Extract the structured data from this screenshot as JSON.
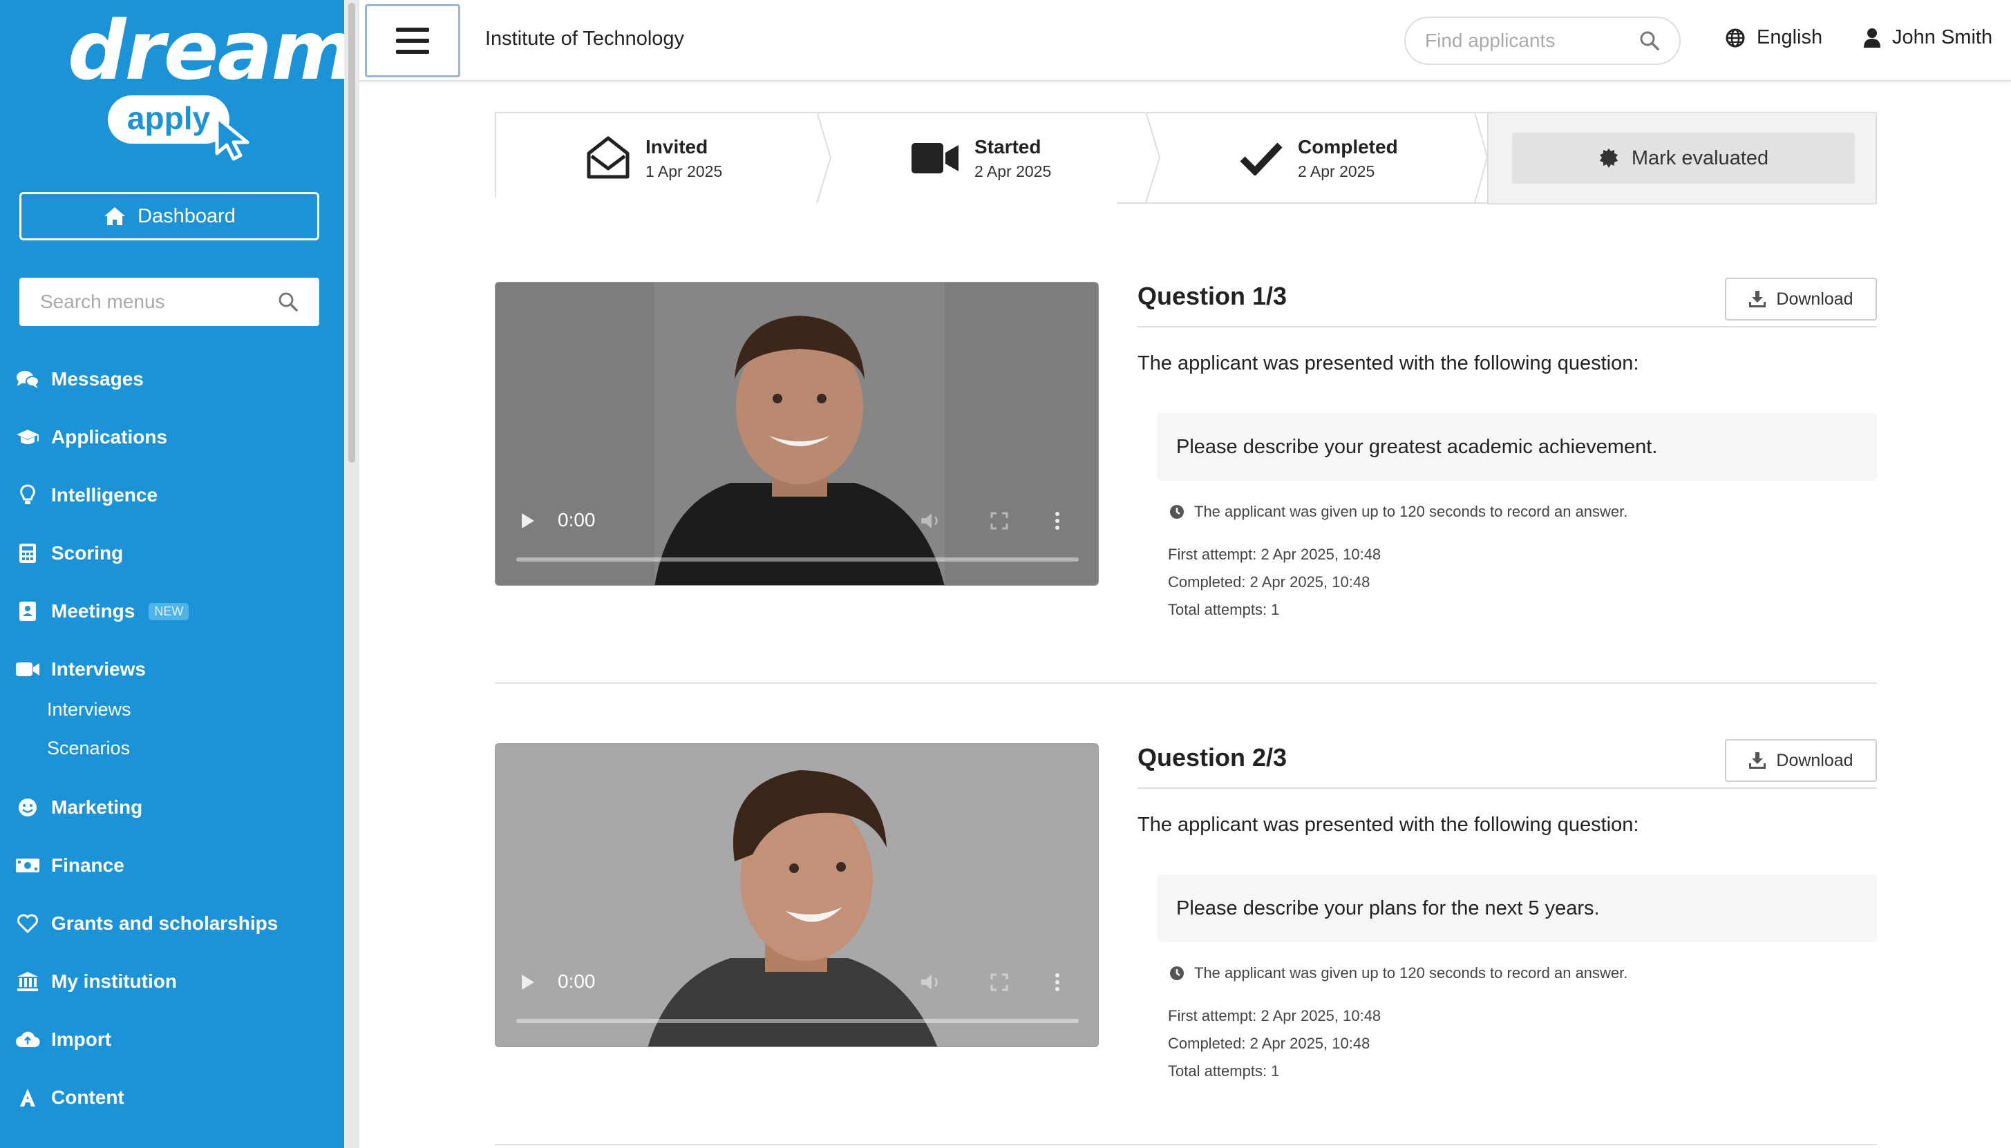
{
  "app": {
    "logo_word": "dream",
    "logo_badge": "apply"
  },
  "sidebar": {
    "dashboard_label": "Dashboard",
    "search_placeholder": "Search menus",
    "items": [
      {
        "label": "Messages",
        "icon": "comments-icon"
      },
      {
        "label": "Applications",
        "icon": "graduation-cap-icon"
      },
      {
        "label": "Intelligence",
        "icon": "lightbulb-icon"
      },
      {
        "label": "Scoring",
        "icon": "calculator-icon"
      },
      {
        "label": "Meetings",
        "icon": "address-card-icon",
        "badge": "NEW"
      },
      {
        "label": "Interviews",
        "icon": "video-camera-icon"
      },
      {
        "label": "Marketing",
        "icon": "smile-icon"
      },
      {
        "label": "Finance",
        "icon": "money-bill-icon"
      },
      {
        "label": "Grants and scholarships",
        "icon": "heart-icon"
      },
      {
        "label": "My institution",
        "icon": "institution-icon"
      },
      {
        "label": "Import",
        "icon": "cloud-upload-icon"
      },
      {
        "label": "Content",
        "icon": "font-icon"
      }
    ],
    "sub_items": [
      {
        "label": "Interviews"
      },
      {
        "label": "Scenarios"
      }
    ]
  },
  "header": {
    "institution": "Institute of Technology",
    "search_placeholder": "Find applicants",
    "language": "English",
    "user": "John Smith"
  },
  "steps": [
    {
      "label": "Invited",
      "date": "1 Apr 2025",
      "icon": "envelope-open-icon"
    },
    {
      "label": "Started",
      "date": "2 Apr 2025",
      "icon": "video-camera-icon"
    },
    {
      "label": "Completed",
      "date": "2 Apr 2025",
      "icon": "checkmark-icon"
    }
  ],
  "mark_evaluated_label": "Mark evaluated",
  "questions": [
    {
      "title": "Question 1/3",
      "download_label": "Download",
      "intro": "The applicant was presented with the following question:",
      "prompt": "Please describe your greatest academic achievement.",
      "time_note": "The applicant was given up to 120 seconds to record an answer.",
      "first_attempt": "First attempt: 2 Apr 2025, 10:48",
      "completed": "Completed: 2 Apr 2025, 10:48",
      "total_attempts": "Total attempts: 1",
      "video_time": "0:00"
    },
    {
      "title": "Question 2/3",
      "download_label": "Download",
      "intro": "The applicant was presented with the following question:",
      "prompt": "Please describe your plans for the next 5 years.",
      "time_note": "The applicant was given up to 120 seconds to record an answer.",
      "first_attempt": "First attempt: 2 Apr 2025, 10:48",
      "completed": "Completed: 2 Apr 2025, 10:48",
      "total_attempts": "Total attempts: 1",
      "video_time": "0:00"
    }
  ],
  "colors": {
    "sidebar_bg": "#1c93d6",
    "header_border": "#e0e0e0",
    "panel_bg": "#f2f2f2"
  }
}
